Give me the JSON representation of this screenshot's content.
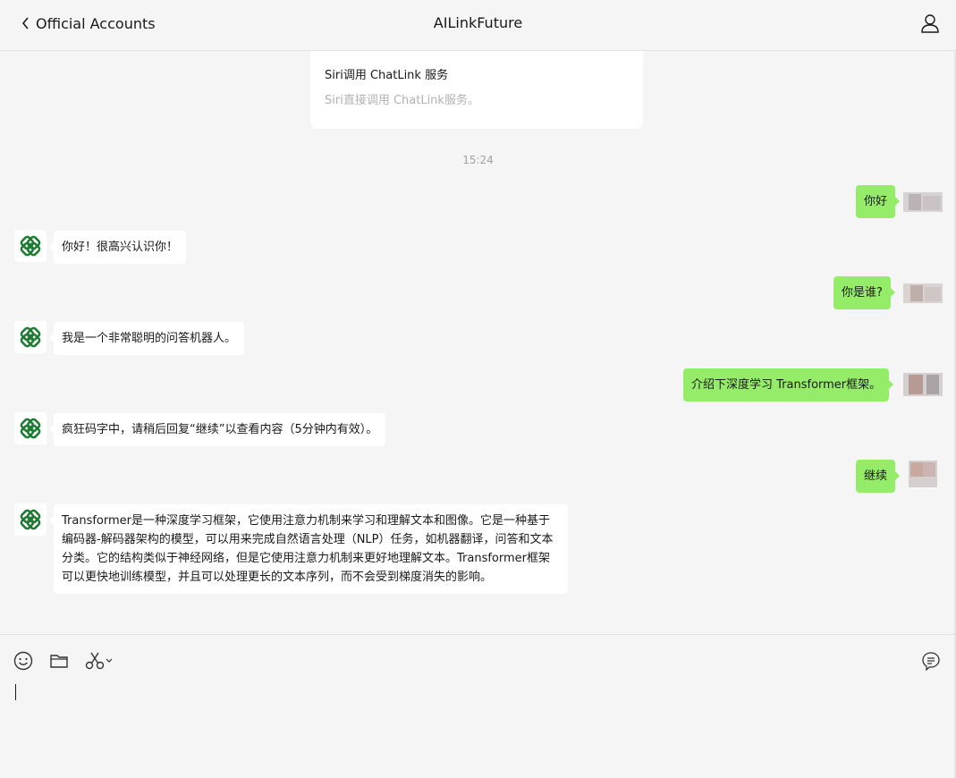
{
  "header": {
    "back_label": "Official Accounts",
    "title": "AILinkFuture"
  },
  "card": {
    "title": "Siri调用 ChatLink 服务",
    "description": "Siri直接调用 ChatLink服务。"
  },
  "timestamp": "15:24",
  "messages": [
    {
      "side": "right",
      "text": "你好"
    },
    {
      "side": "left",
      "text": "你好！很高兴认识你！"
    },
    {
      "side": "right",
      "text": "你是谁?"
    },
    {
      "side": "left",
      "text": "我是一个非常聪明的问答机器人。"
    },
    {
      "side": "right",
      "text": "介绍下深度学习 Transformer框架。"
    },
    {
      "side": "left",
      "text": "疯狂码字中，请稍后回复“继续”以查看内容（5分钟内有效）。"
    },
    {
      "side": "right",
      "text": "继续"
    },
    {
      "side": "left",
      "text": "Transformer是一种深度学习框架，它使用注意力机制来学习和理解文本和图像。它是一种基于编码器-解码器架构的模型，可以用来完成自然语言处理（NLP）任务，如机器翻译，问答和文本分类。它的结构类似于神经网络，但是它使用注意力机制来更好地理解文本。Transformer框架可以更快地训练模型，并且可以处理更长的文本序列，而不会受到梯度消失的影响。"
    }
  ],
  "colors": {
    "bubble_right": "#95ec69",
    "bubble_left": "#ffffff",
    "background": "#f5f5f5",
    "bot_logo": "#1f7a33"
  },
  "icons": {
    "back": "chevron-left-icon",
    "profile": "person-icon",
    "emoji": "emoji-icon",
    "file": "folder-icon",
    "screenshot": "scissors-icon",
    "history": "chat-history-icon"
  }
}
